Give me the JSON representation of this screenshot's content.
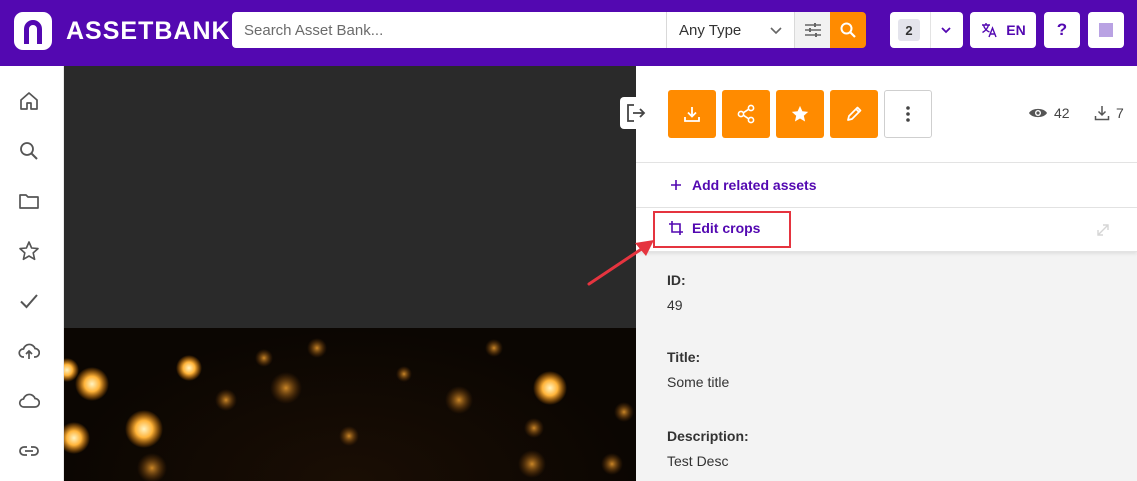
{
  "header": {
    "brand": "ASSETBANK",
    "search_placeholder": "Search Asset Bank...",
    "type_select": "Any Type",
    "lightbox_count": "2",
    "language": "EN",
    "help": "?"
  },
  "sidebar": {
    "items": [
      "home-icon",
      "search-icon",
      "folder-icon",
      "star-icon",
      "check-icon",
      "upload-cloud-icon",
      "cloud-icon",
      "link-icon"
    ]
  },
  "panel": {
    "stats": {
      "views": "42",
      "downloads": "7"
    },
    "add_related": "Add related assets",
    "edit_crops": "Edit crops",
    "fields": [
      {
        "label": "ID:",
        "value": "49"
      },
      {
        "label": "Title:",
        "value": "Some title"
      },
      {
        "label": "Description:",
        "value": "Test Desc"
      }
    ]
  },
  "colors": {
    "brand": "#5308b1",
    "accent": "#ff8b00",
    "highlight": "#e5343f"
  }
}
